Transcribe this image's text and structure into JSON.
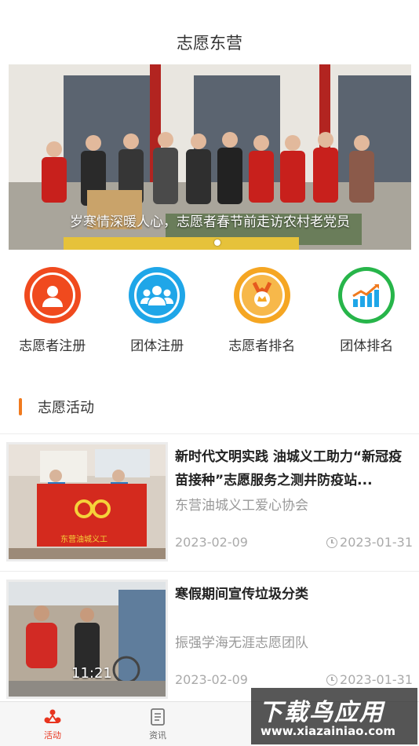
{
  "header": {
    "title": "志愿东营"
  },
  "banner": {
    "caption": "岁寒情深暖人心，志愿者春节前走访农村老党员"
  },
  "quick_actions": [
    {
      "label": "志愿者注册",
      "icon": "person-icon",
      "color": "#f04a1e"
    },
    {
      "label": "团体注册",
      "icon": "group-icon",
      "color": "#1fa6e8"
    },
    {
      "label": "志愿者排名",
      "icon": "medal-icon",
      "color": "#f5a623"
    },
    {
      "label": "团体排名",
      "icon": "growth-chart-icon",
      "color": "#27b54a"
    }
  ],
  "section": {
    "title": "志愿活动"
  },
  "activities": [
    {
      "title": "新时代文明实践 油城义工助力“新冠疫苗接种”志愿服务之测井防疫站...",
      "org": "东营油城义工爱心协会",
      "date_left": "2023-02-09",
      "date_right": "2023-01-31",
      "photo_banner_text": "东营油城义工"
    },
    {
      "title": "寒假期间宣传垃圾分类",
      "org": "振强学海无涯志愿团队",
      "date_left": "2023-02-09",
      "date_right": "2023-01-31",
      "photo_time": "11:21"
    }
  ],
  "tabbar": {
    "tabs": [
      {
        "label": "活动",
        "icon": "activity-icon",
        "active": true
      },
      {
        "label": "资讯",
        "icon": "news-icon",
        "active": false
      }
    ]
  },
  "watermark": {
    "line1": "下载鸟应用",
    "line2": "www.xiazainiao.com"
  },
  "colors": {
    "accent": "#e8351f",
    "section_bar": "#f07a1e"
  }
}
